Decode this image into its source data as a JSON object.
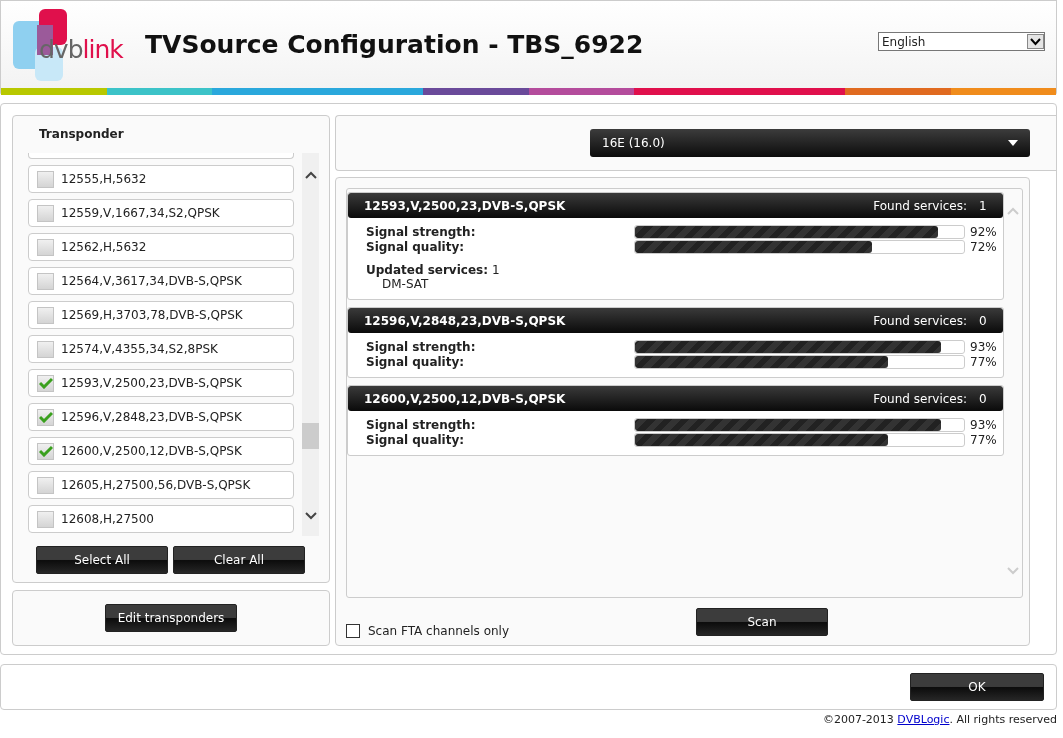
{
  "header": {
    "logo": {
      "part_1": "dvb",
      "part_2": "link"
    },
    "title": "TVSource Configuration - TBS_6922",
    "language": {
      "value": "English"
    }
  },
  "transponder_panel": {
    "heading": "Transponder",
    "items": [
      {
        "label": "12555,H,5632",
        "checked": false
      },
      {
        "label": "12559,V,1667,34,S2,QPSK",
        "checked": false
      },
      {
        "label": "12562,H,5632",
        "checked": false
      },
      {
        "label": "12564,V,3617,34,DVB-S,QPSK",
        "checked": false
      },
      {
        "label": "12569,H,3703,78,DVB-S,QPSK",
        "checked": false
      },
      {
        "label": "12574,V,4355,34,S2,8PSK",
        "checked": false
      },
      {
        "label": "12593,V,2500,23,DVB-S,QPSK",
        "checked": true
      },
      {
        "label": "12596,V,2848,23,DVB-S,QPSK",
        "checked": true
      },
      {
        "label": "12600,V,2500,12,DVB-S,QPSK",
        "checked": true
      },
      {
        "label": "12605,H,27500,56,DVB-S,QPSK",
        "checked": false
      },
      {
        "label": "12608,H,27500",
        "checked": false
      }
    ],
    "buttons": [
      "Select All",
      "Clear All"
    ],
    "edit_button": "Edit transponders"
  },
  "satellite": {
    "value": "16E (16.0)"
  },
  "results": [
    {
      "name": "12593,V,2500,23,DVB-S,QPSK",
      "found_label": "Found services:",
      "found": "1",
      "rows": [
        {
          "label": "Signal strength:",
          "level": 0.92,
          "reading": "92%"
        },
        {
          "label": "Signal quality:",
          "level": 0.72,
          "reading": "72%"
        }
      ],
      "updated_label": "Updated services:",
      "updated_count": "1",
      "updated_services": [
        "DM-SAT"
      ]
    },
    {
      "name": "12596,V,2848,23,DVB-S,QPSK",
      "found_label": "Found services:",
      "found": "0",
      "rows": [
        {
          "label": "Signal strength:",
          "level": 0.93,
          "reading": "93%"
        },
        {
          "label": "Signal quality:",
          "level": 0.77,
          "reading": "77%"
        }
      ]
    },
    {
      "name": "12600,V,2500,12,DVB-S,QPSK",
      "found_label": "Found services:",
      "found": "0",
      "rows": [
        {
          "label": "Signal strength:",
          "level": 0.93,
          "reading": "93%"
        },
        {
          "label": "Signal quality:",
          "level": 0.77,
          "reading": "77%"
        }
      ]
    }
  ],
  "fta": {
    "label": "Scan FTA channels only",
    "checked": false
  },
  "scan_button": "Scan",
  "ok_button": "OK",
  "copyright": {
    "before": "©2007-2013 ",
    "link": "DVBLogic",
    "after": ". All rights reserved"
  }
}
